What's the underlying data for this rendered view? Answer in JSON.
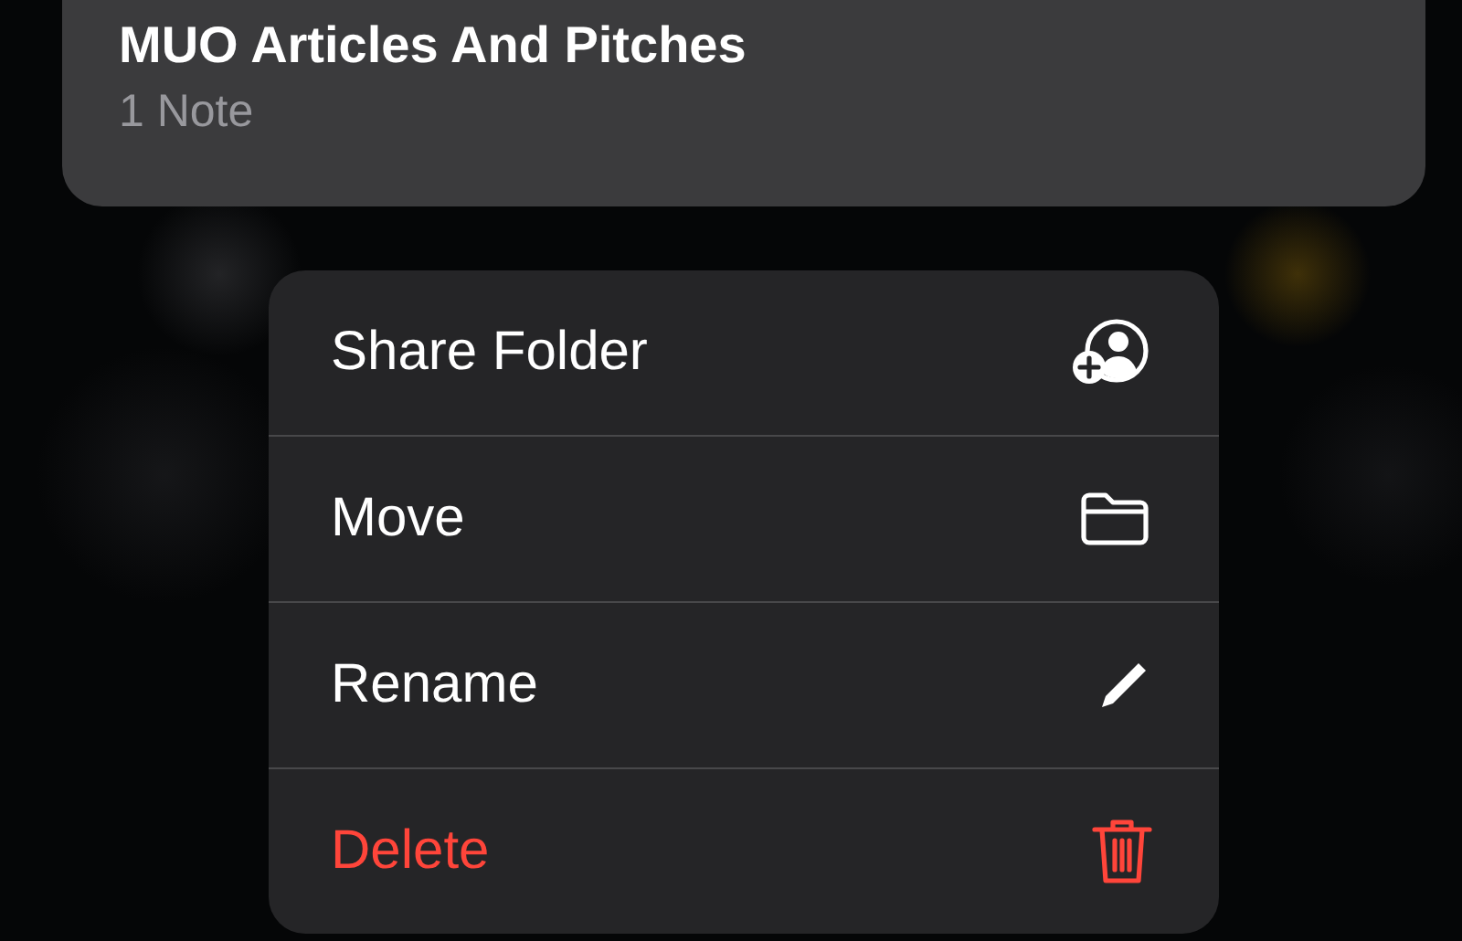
{
  "folder": {
    "title": "MUO Articles And Pitches",
    "subtitle": "1 Note"
  },
  "menu": [
    {
      "label": "Share Folder",
      "kind": "share"
    },
    {
      "label": "Move",
      "kind": "move"
    },
    {
      "label": "Rename",
      "kind": "rename"
    },
    {
      "label": "Delete",
      "kind": "delete"
    }
  ]
}
